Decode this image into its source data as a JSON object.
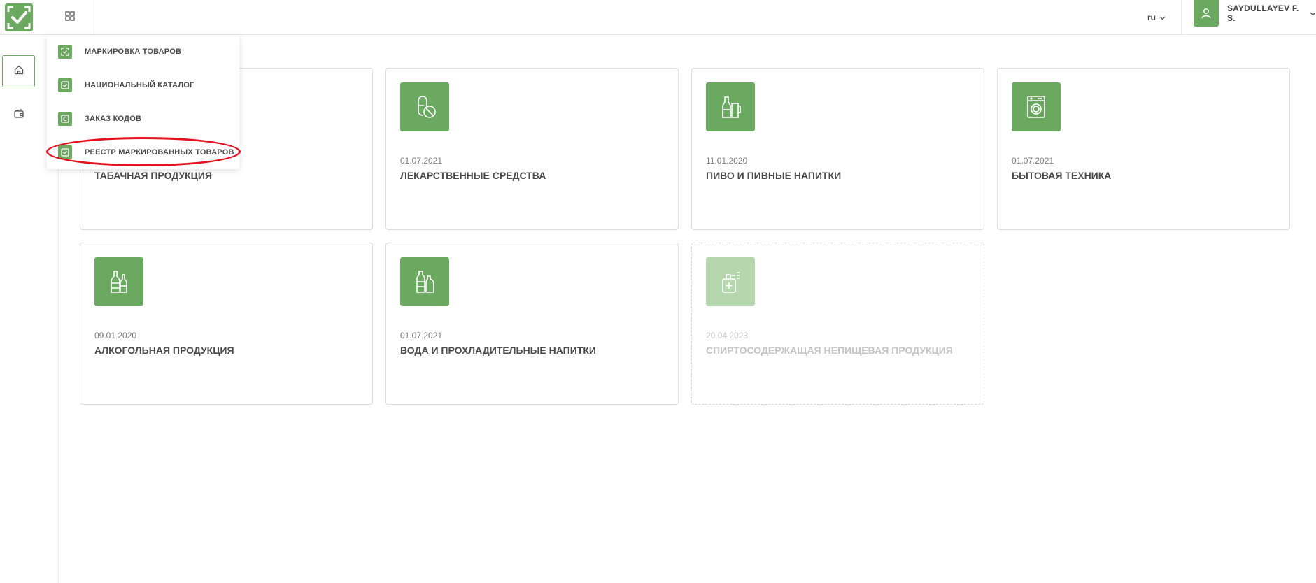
{
  "header": {
    "language": "ru",
    "user_name": "SAYDULLAYEV F. S."
  },
  "icons": {
    "logo": "check-logo-icon",
    "apps": "grid-icon",
    "home": "home-icon",
    "wallet": "wallet-icon",
    "user": "user-icon"
  },
  "colors": {
    "accent": "#6aa95f",
    "accent_disabled": "#b5d7ad",
    "highlight": "#e3121e"
  },
  "menu": {
    "items": [
      {
        "label": "МАРКИРОВКА ТОВАРОВ",
        "icon": "scan-icon"
      },
      {
        "label": "НАЦИОНАЛЬНЫЙ КАТАЛОГ",
        "icon": "check-box-icon"
      },
      {
        "label": "ЗАКАЗ КОДОВ",
        "icon": "code-order-icon"
      },
      {
        "label": "РЕЕСТР МАРКИРОВАННЫХ ТОВАРОВ",
        "icon": "check-box-icon"
      }
    ],
    "highlighted_index": 3
  },
  "cards": [
    {
      "date": "",
      "title": "ТАБАЧНАЯ ПРОДУКЦИЯ",
      "icon": "tobacco-icon",
      "enabled": true
    },
    {
      "date": "01.07.2021",
      "title": "ЛЕКАРСТВЕННЫЕ СРЕДСТВА",
      "icon": "pills-icon",
      "enabled": true
    },
    {
      "date": "11.01.2020",
      "title": "ПИВО И ПИВНЫЕ НАПИТКИ",
      "icon": "beer-icon",
      "enabled": true
    },
    {
      "date": "01.07.2021",
      "title": "БЫТОВАЯ ТЕХНИКА",
      "icon": "washing-machine-icon",
      "enabled": true
    },
    {
      "date": "09.01.2020",
      "title": "АЛКОГОЛЬНАЯ ПРОДУКЦИЯ",
      "icon": "alcohol-bottles-icon",
      "enabled": true
    },
    {
      "date": "01.07.2021",
      "title": "ВОДА И ПРОХЛАДИТЕЛЬНЫЕ НАПИТКИ",
      "icon": "water-bottles-icon",
      "enabled": true
    },
    {
      "date": "20.04.2023",
      "title": "СПИРТОСОДЕРЖАЩАЯ НЕПИЩЕВАЯ ПРОДУКЦИЯ",
      "icon": "sanitizer-icon",
      "enabled": false
    }
  ]
}
